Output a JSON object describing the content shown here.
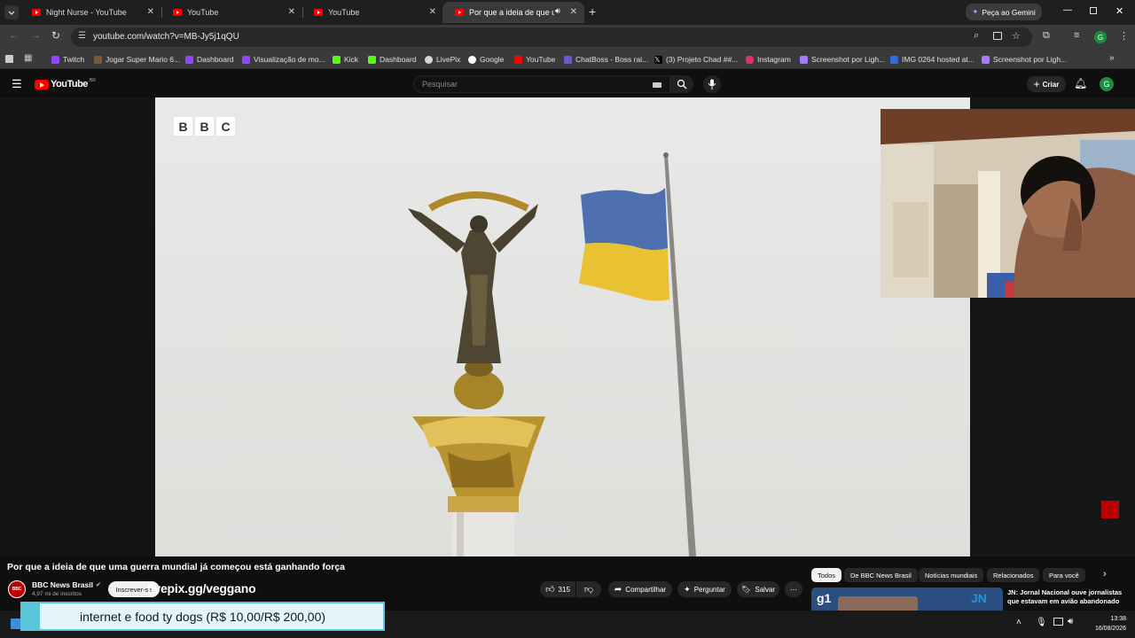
{
  "browser": {
    "tabs": [
      {
        "label": "Night Nurse - YouTube"
      },
      {
        "label": "YouTube"
      },
      {
        "label": "YouTube"
      },
      {
        "label": "Por que a ideia de que uma"
      }
    ],
    "gemini_label": "Peça ao Gemini",
    "url": "youtube.com/watch?v=MB-Jy5j1qQU",
    "bookmarks": [
      {
        "label": "Twitch",
        "color": "#9146ff"
      },
      {
        "label": "Jogar Super Mario 6...",
        "color": "#7a5a3a"
      },
      {
        "label": "Dashboard",
        "color": "#9146ff"
      },
      {
        "label": "Visualização de mo...",
        "color": "#9146ff"
      },
      {
        "label": "Kick",
        "color": "#53fc18"
      },
      {
        "label": "Dashboard",
        "color": "#53fc18"
      },
      {
        "label": "LivePix",
        "color": "#cfd8dc"
      },
      {
        "label": "Google",
        "color": "#ffffff"
      },
      {
        "label": "YouTube",
        "color": "#ff0000"
      },
      {
        "label": "ChatBoss - Boss rai...",
        "color": "#6a5acd"
      },
      {
        "label": "(3) Projeto Chad ##...",
        "color": "#000000"
      },
      {
        "label": "Instagram",
        "color": "#e1306c"
      },
      {
        "label": "Screenshot por Ligh...",
        "color": "#a67cff"
      },
      {
        "label": "IMG 0264 hosted at...",
        "color": "#2f6fd6"
      },
      {
        "label": "Screenshot por Ligh...",
        "color": "#a67cff"
      }
    ]
  },
  "youtube": {
    "logo_text": "YouTube",
    "logo_country": "BR",
    "search_placeholder": "Pesquisar",
    "create_label": "Criar",
    "avatar_letter": "G",
    "video_watermark": [
      "B",
      "B",
      "C"
    ],
    "title": "Por que a ideia de que uma guerra mundial já começou está ganhando força",
    "channel_name": "BBC News Brasil",
    "subscribers": "4,97 mi de inscritos",
    "subscribe_label": "Inscrever-se",
    "overlay_text": "livepix.gg/veggano",
    "likes": "315",
    "share_label": "Compartilhar",
    "ask_label": "Perguntar",
    "save_label": "Salvar",
    "chips": [
      "Todos",
      "De BBC News Brasil",
      "Notícias mundiais",
      "Relacionados",
      "Para você"
    ],
    "rec_title_line1": "JN: Jornal Nacional ouve jornalistas",
    "rec_title_line2": "que estavam em avião abandonado",
    "rec_thumb_text": "g1",
    "rec_thumb_text2": "JN"
  },
  "donation": {
    "text": "internet e food ty dogs (R$ 10,00/R$ 200,00)",
    "progress": 0.05
  },
  "taskbar": {
    "time": "13:38",
    "date": "16/08/2026"
  }
}
